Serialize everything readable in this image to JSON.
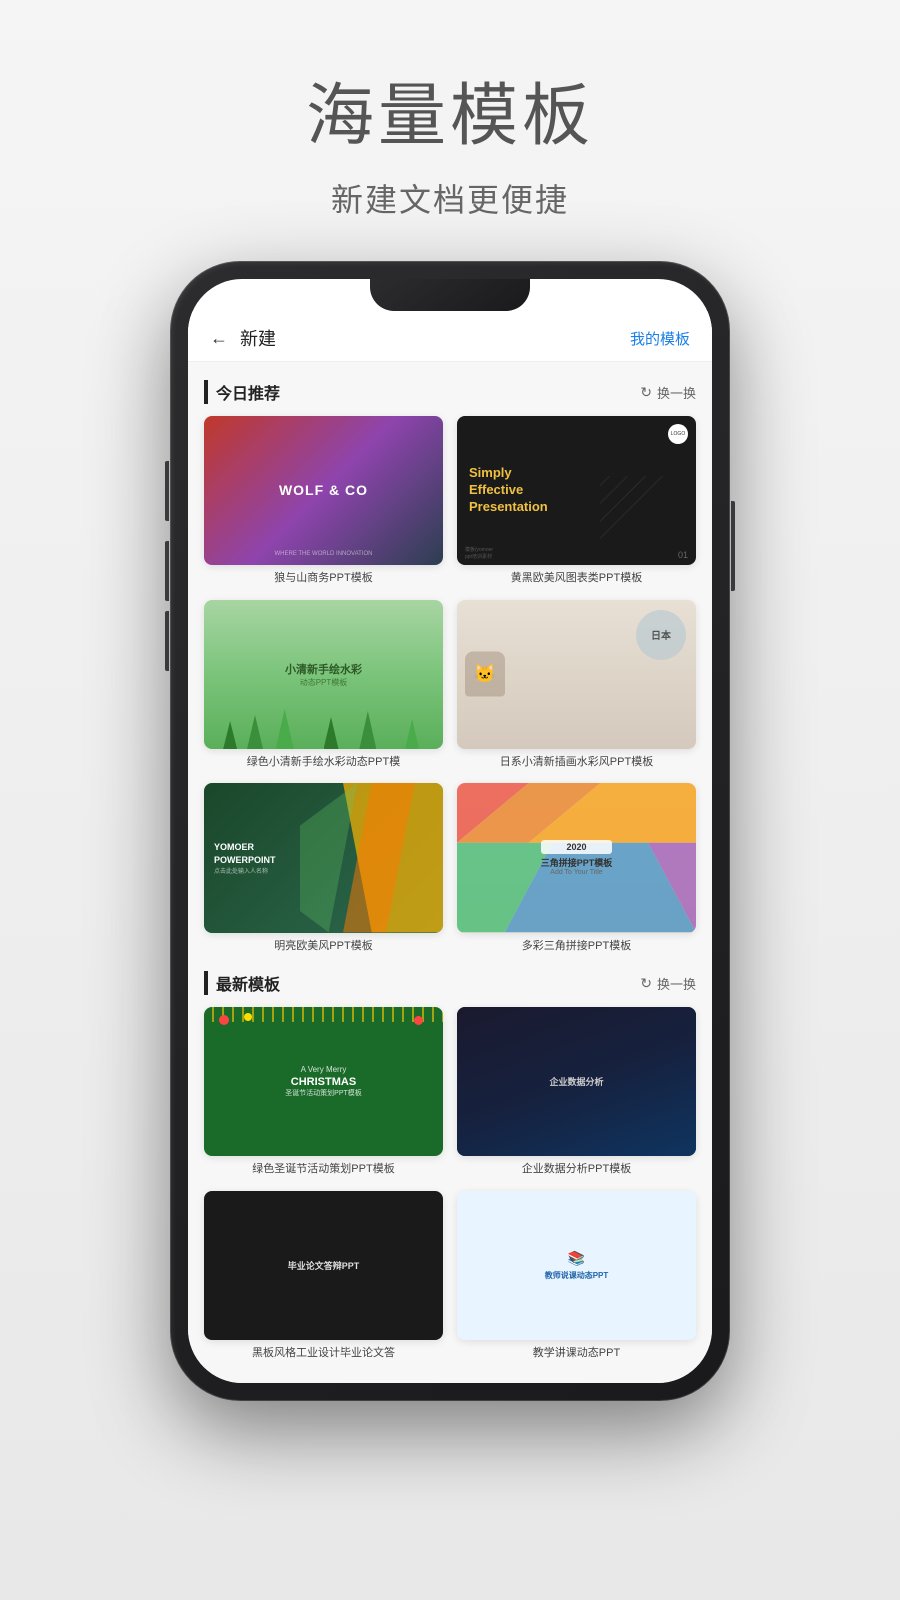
{
  "page": {
    "main_title": "海量模板",
    "subtitle": "新建文档更便捷"
  },
  "app": {
    "top_bar": {
      "title": "新建",
      "my_templates": "我的模板"
    },
    "sections": [
      {
        "id": "today",
        "title": "今日推荐",
        "action": "换一换",
        "templates": [
          {
            "id": "wolf",
            "name": "狼与山商务PPT模板",
            "title_line1": "WOLF & CO",
            "subtitle": "WHERE THE WORLD INNOVATION"
          },
          {
            "id": "black",
            "name": "黄黑欧美风图表类PPT模板",
            "title": "Simply\nEffective\nPresentation",
            "logo": "LOGO",
            "num": "01"
          },
          {
            "id": "watercolor",
            "name": "绿色小清新手绘水彩动态PPT模",
            "title": "小清新手绘水彩",
            "sub": "动态PPT模板"
          },
          {
            "id": "japan",
            "name": "日系小清新插画水彩风PPT模板",
            "circle_text": "日本"
          },
          {
            "id": "poly-green",
            "name": "明亮欧美风PPT模板",
            "brand": "YOMOER",
            "product": "POWERPOINT",
            "sub": "点击此处输入人名称"
          },
          {
            "id": "triangle",
            "name": "多彩三角拼接PPT模板",
            "title": "三角拼接PPT模板",
            "sub": "Add To Your Title"
          }
        ]
      },
      {
        "id": "latest",
        "title": "最新模板",
        "action": "换一换",
        "templates": [
          {
            "id": "christmas",
            "name": "绿色圣诞节活动策划PPT模板",
            "big": "A Very Merry\nCHRISTMAS",
            "sub": "圣诞节活动策划PPT模板"
          },
          {
            "id": "business-data",
            "name": "企业数据分析PPT模板",
            "title": "企业数据分析"
          },
          {
            "id": "blackboard",
            "name": "黑板风格工业设计毕业论文答",
            "title": "毕业论文答辩PPT"
          },
          {
            "id": "teacher",
            "name": "教学讲课动态PPT",
            "title": "教师说课动态PPT"
          }
        ]
      }
    ]
  }
}
